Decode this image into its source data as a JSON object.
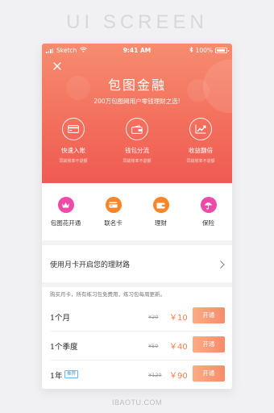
{
  "showcase": {
    "title": "UI SCREEN",
    "watermark": "IBAOTU.COM"
  },
  "status_bar": {
    "carrier": "Sketch",
    "time": "9:41 AM",
    "battery": "100%"
  },
  "hero": {
    "title": "包图金融",
    "subtitle": "200万包图网用户零钱理财之选!",
    "features": [
      {
        "label": "快速入账",
        "sub": "同故账率不退额",
        "icon": "card-icon"
      },
      {
        "label": "钱包分流",
        "sub": "同故账率不退额",
        "icon": "wallet-icon"
      },
      {
        "label": "收益翻倍",
        "sub": "同故账率不退额",
        "icon": "growth-chart-icon"
      }
    ]
  },
  "quick_actions": [
    {
      "label": "包图花开通",
      "icon": "crown-icon",
      "color": "#ee4ba9"
    },
    {
      "label": "联名卡",
      "icon": "card-icon",
      "color": "#f7852a"
    },
    {
      "label": "理财",
      "icon": "wallet-icon",
      "color": "#f7852a"
    },
    {
      "label": "保险",
      "icon": "umbrella-icon",
      "color": "#ee4ba9"
    }
  ],
  "monthly": {
    "label": "使用月卡开启您的理财路"
  },
  "plans": {
    "intro": "购买月卡，所有练习包免费用，练习包每周更新。",
    "items": [
      {
        "name": "1个月",
        "tag": "",
        "old_price": "¥20",
        "price": "￥10",
        "button": "开通"
      },
      {
        "name": "1个季度",
        "tag": "",
        "old_price": "¥50",
        "price": "￥40",
        "button": "开通"
      },
      {
        "name": "1年",
        "tag": "推荐",
        "old_price": "¥120",
        "price": "￥90",
        "button": "开通"
      }
    ]
  },
  "colors": {
    "hero_top": "#f78c6f",
    "hero_bottom": "#ef5a52",
    "accent": "#f47f44",
    "pink": "#ee4ba9",
    "orange": "#f7852a"
  }
}
